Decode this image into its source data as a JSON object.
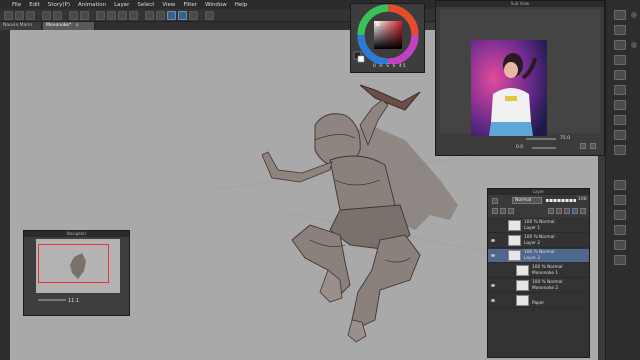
{
  "menu": [
    "File",
    "Edit",
    "Story(P)",
    "Animation",
    "Layer",
    "Select",
    "View",
    "Filter",
    "Window",
    "Help"
  ],
  "tabs": [
    {
      "label": "Naosia Marin"
    },
    {
      "label": "Mononoke*",
      "close": "x"
    }
  ],
  "color_panel": {
    "footer": "0  H  S  V  45"
  },
  "subview": {
    "title": "Sub View",
    "zoom": "75.0",
    "angle": "0.0"
  },
  "navigator": {
    "title": "Navigator",
    "zoom": "11.1"
  },
  "layer_panel": {
    "title": "Layer",
    "blend_mode": "Normal",
    "opacity": "100",
    "layers": [
      {
        "blend": "100 % Normal",
        "name": "Layer 1",
        "visible": false,
        "selected": false,
        "indent": 0
      },
      {
        "blend": "100 % Normal",
        "name": "Layer 2",
        "visible": true,
        "selected": false,
        "indent": 0
      },
      {
        "blend": "100 % Normal",
        "name": "Layer 3",
        "visible": true,
        "selected": true,
        "indent": 0
      },
      {
        "blend": "100 % Normal",
        "name": "Mononoke 1",
        "visible": false,
        "selected": false,
        "indent": 1
      },
      {
        "blend": "100 % Normal",
        "name": "Mononoke 2",
        "visible": true,
        "selected": false,
        "indent": 1
      },
      {
        "blend": "",
        "name": "Paper",
        "visible": true,
        "selected": false,
        "indent": 1
      }
    ]
  },
  "colors": {
    "canvas": "#a9a9a9",
    "accent": "#4f678c",
    "navigator_frame": "#e33333"
  }
}
